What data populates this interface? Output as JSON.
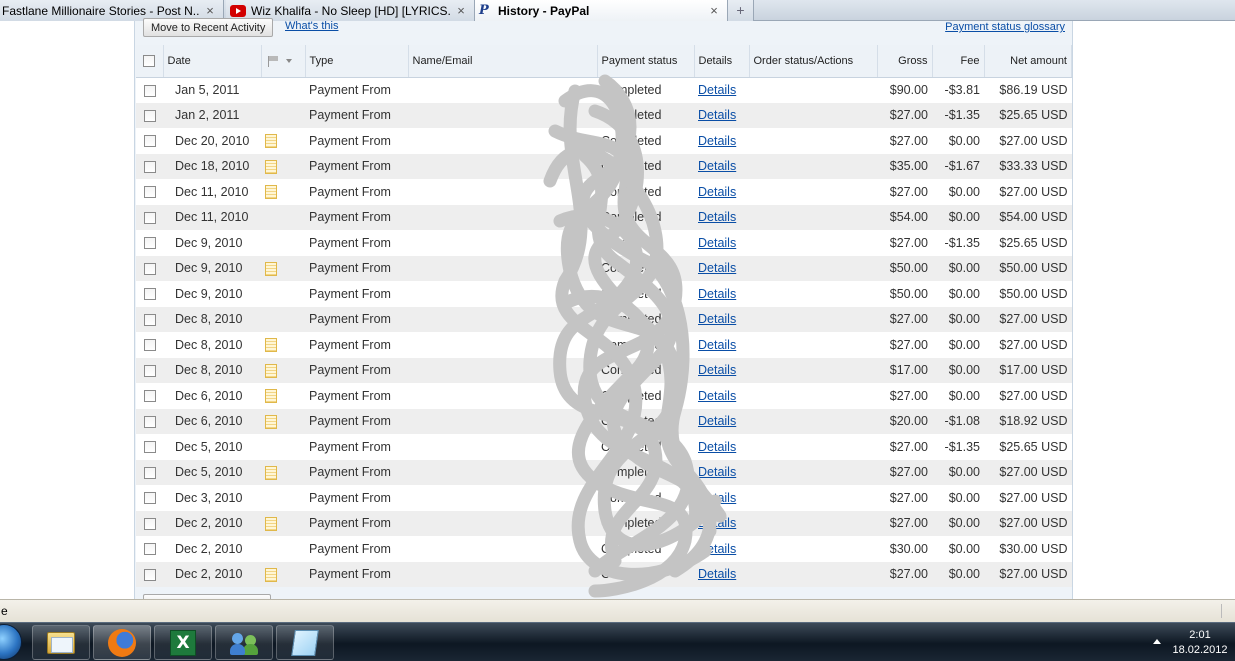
{
  "browser": {
    "tabs": [
      {
        "label": "Fastlane Millionaire Stories - Post N...",
        "favicon": "none",
        "active": false
      },
      {
        "label": "Wiz Khalifa - No Sleep [HD] [LYRICS...",
        "favicon": "youtube-icon",
        "active": false
      },
      {
        "label": "History - PayPal",
        "favicon": "paypal-icon",
        "active": true
      }
    ],
    "close_glyph": "×",
    "new_tab_glyph": "+",
    "status_text": "e"
  },
  "toolbar": {
    "recent_button": "Move to Recent Activity",
    "whats_this": "What's this",
    "glossary": "Payment status glossary"
  },
  "table": {
    "columns": [
      "Date",
      "",
      "Type",
      "Name/Email",
      "Payment status",
      "Details",
      "Order status/Actions",
      "Gross",
      "Fee",
      "Net amount"
    ],
    "rows": [
      {
        "date": "Jan 5, 2011",
        "note": false,
        "type": "Payment From",
        "status": "Completed",
        "details": "Details",
        "gross": "$90.00",
        "fee": "-$3.81",
        "net": "$86.19 USD"
      },
      {
        "date": "Jan 2, 2011",
        "note": false,
        "type": "Payment From",
        "status": "Completed",
        "details": "Details",
        "gross": "$27.00",
        "fee": "-$1.35",
        "net": "$25.65 USD"
      },
      {
        "date": "Dec 20, 2010",
        "note": true,
        "type": "Payment From",
        "status": "Completed",
        "details": "Details",
        "gross": "$27.00",
        "fee": "$0.00",
        "net": "$27.00 USD"
      },
      {
        "date": "Dec 18, 2010",
        "note": true,
        "type": "Payment From",
        "status": "Completed",
        "details": "Details",
        "gross": "$35.00",
        "fee": "-$1.67",
        "net": "$33.33 USD"
      },
      {
        "date": "Dec 11, 2010",
        "note": true,
        "type": "Payment From",
        "status": "Completed",
        "details": "Details",
        "gross": "$27.00",
        "fee": "$0.00",
        "net": "$27.00 USD"
      },
      {
        "date": "Dec 11, 2010",
        "note": false,
        "type": "Payment From",
        "status": "Completed",
        "details": "Details",
        "gross": "$54.00",
        "fee": "$0.00",
        "net": "$54.00 USD"
      },
      {
        "date": "Dec 9, 2010",
        "note": false,
        "type": "Payment From",
        "status": "Completed",
        "details": "Details",
        "gross": "$27.00",
        "fee": "-$1.35",
        "net": "$25.65 USD"
      },
      {
        "date": "Dec 9, 2010",
        "note": true,
        "type": "Payment From",
        "status": "Completed",
        "details": "Details",
        "gross": "$50.00",
        "fee": "$0.00",
        "net": "$50.00 USD"
      },
      {
        "date": "Dec 9, 2010",
        "note": false,
        "type": "Payment From",
        "status": "Completed",
        "details": "Details",
        "gross": "$50.00",
        "fee": "$0.00",
        "net": "$50.00 USD"
      },
      {
        "date": "Dec 8, 2010",
        "note": false,
        "type": "Payment From",
        "status": "Completed",
        "details": "Details",
        "gross": "$27.00",
        "fee": "$0.00",
        "net": "$27.00 USD"
      },
      {
        "date": "Dec 8, 2010",
        "note": true,
        "type": "Payment From",
        "status": "Completed",
        "details": "Details",
        "gross": "$27.00",
        "fee": "$0.00",
        "net": "$27.00 USD"
      },
      {
        "date": "Dec 8, 2010",
        "note": true,
        "type": "Payment From",
        "status": "Completed",
        "details": "Details",
        "gross": "$17.00",
        "fee": "$0.00",
        "net": "$17.00 USD"
      },
      {
        "date": "Dec 6, 2010",
        "note": true,
        "type": "Payment From",
        "status": "Completed",
        "details": "Details",
        "gross": "$27.00",
        "fee": "$0.00",
        "net": "$27.00 USD"
      },
      {
        "date": "Dec 6, 2010",
        "note": true,
        "type": "Payment From",
        "status": "Completed",
        "details": "Details",
        "gross": "$20.00",
        "fee": "-$1.08",
        "net": "$18.92 USD"
      },
      {
        "date": "Dec 5, 2010",
        "note": false,
        "type": "Payment From",
        "status": "Completed",
        "details": "Details",
        "gross": "$27.00",
        "fee": "-$1.35",
        "net": "$25.65 USD"
      },
      {
        "date": "Dec 5, 2010",
        "note": true,
        "type": "Payment From",
        "status": "Completed",
        "details": "Details",
        "gross": "$27.00",
        "fee": "$0.00",
        "net": "$27.00 USD"
      },
      {
        "date": "Dec 3, 2010",
        "note": false,
        "type": "Payment From",
        "status": "Completed",
        "details": "Details",
        "gross": "$27.00",
        "fee": "$0.00",
        "net": "$27.00 USD"
      },
      {
        "date": "Dec 2, 2010",
        "note": true,
        "type": "Payment From",
        "status": "Completed",
        "details": "Details",
        "gross": "$27.00",
        "fee": "$0.00",
        "net": "$27.00 USD"
      },
      {
        "date": "Dec 2, 2010",
        "note": false,
        "type": "Payment From",
        "status": "Completed",
        "details": "Details",
        "gross": "$30.00",
        "fee": "$0.00",
        "net": "$30.00 USD"
      },
      {
        "date": "Dec 2, 2010",
        "note": true,
        "type": "Payment From",
        "status": "Completed",
        "details": "Details",
        "gross": "$27.00",
        "fee": "$0.00",
        "net": "$27.00 USD"
      }
    ]
  },
  "taskbar": {
    "apps": [
      {
        "name": "windows-explorer-icon",
        "active": false
      },
      {
        "name": "firefox-icon",
        "active": true
      },
      {
        "name": "excel-icon",
        "active": false
      },
      {
        "name": "messenger-icon",
        "active": false
      },
      {
        "name": "notepad-icon",
        "active": false
      }
    ],
    "time": "2:01",
    "date": "18.02.2012"
  },
  "colors": {
    "link": "#0a4ea6",
    "row_alt": "#eeeeee",
    "redaction": "#c4c4c4"
  }
}
